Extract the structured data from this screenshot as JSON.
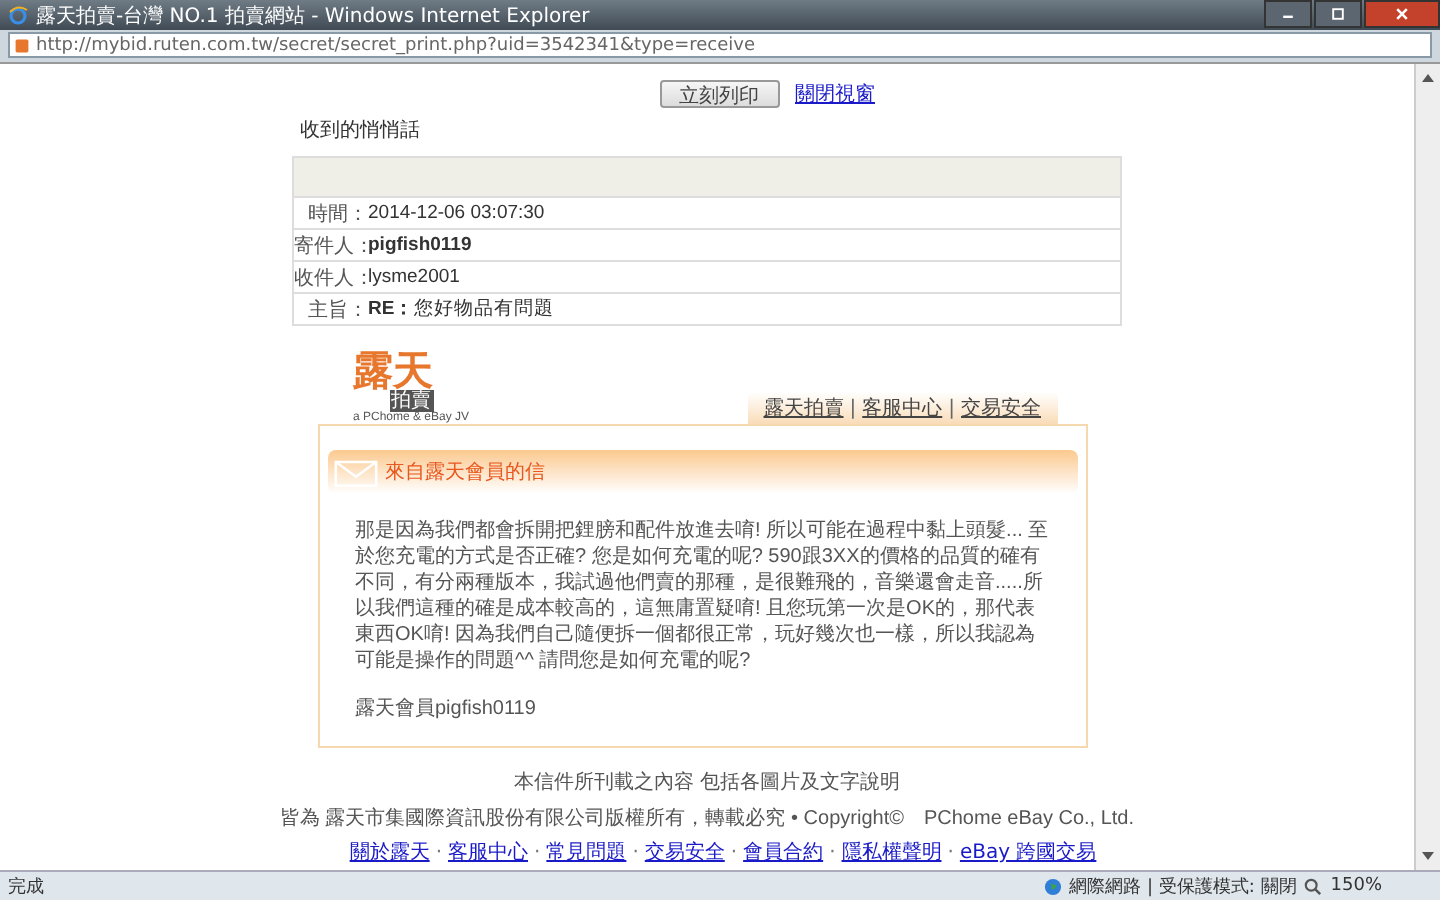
{
  "window": {
    "title": "露天拍賣-台灣 NO.1 拍賣網站 - Windows Internet Explorer"
  },
  "address_bar": {
    "url": "http://mybid.ruten.com.tw/secret/secret_print.php?uid=3542341&type=receive"
  },
  "actions": {
    "print_button": "立刻列印",
    "close_link": "關閉視窗"
  },
  "heading": "收到的悄悄話",
  "message_fields": [
    {
      "label": "時間：",
      "value": "2014-12-06 03:07:30",
      "bold": false
    },
    {
      "label": "寄件人：",
      "value": "pigfish0119",
      "bold": true
    },
    {
      "label": "收件人：",
      "value": "lysme2001",
      "bold": false
    },
    {
      "label": "主旨：",
      "value": "**RE：**您好物品有問題",
      "bold": false
    }
  ],
  "logo": {
    "main": "露天",
    "badge": "拍賣",
    "tagline": "a PChome & eBay JV"
  },
  "tabs": {
    "separator": "|",
    "items": [
      "露天拍賣",
      "客服中心",
      "交易安全"
    ]
  },
  "card": {
    "title": "來自露天會員的信",
    "body": "那是因為我們都會拆開把鋰膀和配件放進去唷! 所以可能在過程中黏上頭髮... 至於您充電的方式是否正確? 您是如何充電的呢? 590跟3XX的價格的品質的確有不同，有分兩種版本，我試過他們賣的那種，是很難飛的，音樂還會走音.....所以我們這種的確是成本較高的，這無庸置疑唷! 且您玩第一次是OK的，那代表東西OK唷! 因為我們自己隨便拆一個都很正常，玩好幾次也一樣，所以我認為可能是操作的問題^^ 請問您是如何充電的呢?",
    "signature": "露天會員pigfish0119"
  },
  "copyright": [
    "本信件所刊載之內容 包括各圖片及文字說明",
    "皆為 露天市集國際資訊股份有限公司版權所有，轉載必究 • Copyright©　PChome eBay Co., Ltd."
  ],
  "footer_links": {
    "separator": "·",
    "items": [
      "關於露天",
      "客服中心",
      "常見問題",
      "交易安全",
      "會員合約",
      "隱私權聲明",
      "eBay 跨國交易"
    ]
  },
  "status_bar": {
    "status": "完成",
    "zone": "網際網路 | 受保護模式: 關閉",
    "zoom": "150%"
  }
}
